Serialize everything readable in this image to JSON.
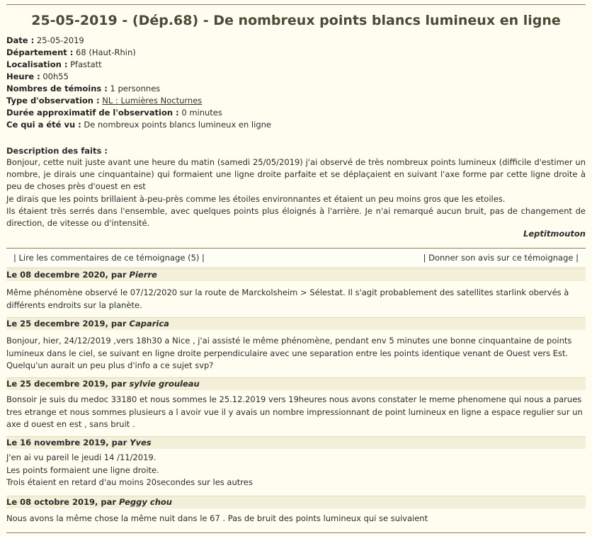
{
  "title": "25-05-2019 - (Dép.68) - De nombreux points blancs lumineux en ligne",
  "meta": [
    {
      "label": "Date :",
      "value": " 25-05-2019"
    },
    {
      "label": "Département :",
      "value": " 68 (Haut-Rhin)"
    },
    {
      "label": "Localisation :",
      "value": " Pfastatt"
    },
    {
      "label": "Heure :",
      "value": " 00h55"
    },
    {
      "label": "Nombres de témoins :",
      "value": " 1 personnes"
    },
    {
      "label": "Type d'observation :",
      "value": "NL : Lumières Nocturnes"
    },
    {
      "label": "Durée approximatif de l'observation :",
      "value": " 0 minutes"
    },
    {
      "label": "Ce qui a été vu :",
      "value": " De nombreux points blancs lumineux en ligne"
    }
  ],
  "description": {
    "heading": "Description des faits :",
    "paragraphs": [
      "Bonjour, cette nuit juste avant une heure du matin (samedi 25/05/2019) j'ai observé de très nombreux points lumineux (difficile d'estimer un nombre, je dirais une cinquantaine) qui formaient une ligne droite parfaite et se déplaçaient en suivant l'axe forme par cette ligne droite à peu de choses près d'ouest en est",
      "Je dirais que les points brillaient à-peu-près comme les étoiles environnantes et étaient un peu moins gros que les etoiles.",
      "Ils étaient très serrés dans l'ensemble, avec quelques points plus éloignés à l'arrière. Je n'ai remarqué aucun bruit, pas de changement de direction, de vitesse ou d'intensité."
    ],
    "author": "Leptitmouton"
  },
  "links": {
    "comments": "| Lire les commentaires de ce témoignage (5) |",
    "opinion": "| Donner son avis sur ce témoignage |"
  },
  "comments": [
    {
      "date_prefix": "Le 08 decembre 2020, par ",
      "author": "Pierre",
      "lines": [
        "Même phénomène observé le 07/12/2020 sur la route de Marckolsheim > Sélestat. Il s'agit probablement des satellites starlink obervés à différents endroits sur la planète."
      ]
    },
    {
      "date_prefix": "Le 25 decembre 2019, par ",
      "author": "Caparica",
      "lines": [
        "Bonjour, hier, 24/12/2019 ,vers 18h30 a Nice , j'ai assisté le même phénomène, pendant env 5 minutes une bonne cinquantaine de points lumineux dans le ciel, se suivant en ligne droite perpendiculaire avec une separation entre les points identique venant de Ouest vers Est. Quelqu'un aurait un peu plus d'info a ce sujet svp?"
      ]
    },
    {
      "date_prefix": "Le 25 decembre 2019, par ",
      "author": "sylvie grouleau",
      "lines": [
        "Bonsoir je suis du medoc 33180 et nous sommes le 25.12.2019 vers 19heures nous avons constater le meme phenomene qui nous a parues tres etrange et nous sommes plusieurs a l avoir vue il y avais un nombre impressionnant de point lumineux en ligne a espace regulier sur un axe d ouest en est , sans bruit ."
      ]
    },
    {
      "date_prefix": "Le 16 novembre 2019, par ",
      "author": "Yves",
      "lines": [
        "J'en ai vu pareil le jeudi 14 /11/2019.",
        "Les points formaient une ligne droite.",
        "Trois étaient en retard d'au moins 20secondes sur les autres"
      ]
    },
    {
      "date_prefix": "Le 08 octobre 2019, par ",
      "author": "Peggy chou",
      "lines": [
        "Nous avons la même chose la même nuit dans le 67 . Pas de bruit des points lumineux qui se suivaient"
      ]
    }
  ]
}
